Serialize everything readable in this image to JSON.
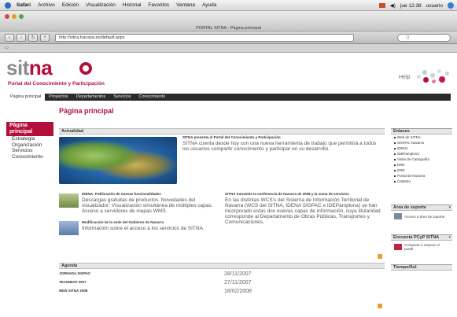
{
  "menubar": {
    "app": "Safari",
    "items": [
      "Archivo",
      "Edición",
      "Visualización",
      "Historial",
      "Favoritos",
      "Ventana",
      "Ayuda"
    ],
    "time": "jue 12:38",
    "user": "usuario"
  },
  "window": {
    "title": "PORTAL SITNA - Página principal",
    "url": "http://sitna.tracasa.es/default.aspx"
  },
  "site": {
    "logo": "sitna",
    "tagline": "Portal del Conocimiento y Participación",
    "help": "Help",
    "nav": [
      "Página principal",
      "Proyectos",
      "Departamentos",
      "Servicios",
      "Conocimiento"
    ],
    "page_title": "Página principal"
  },
  "leftnav": {
    "header": "Página principal",
    "items": [
      "Estrategia",
      "Organización",
      "Servicios",
      "Conocimiento"
    ]
  },
  "main": {
    "actualidad_header": "Actualidad",
    "lead_title": "SITNA presenta el Portal del Conocimiento y Participación",
    "lead_body": "SITNA cuenta desde hoy con una nueva herramienta de trabajo que permitirá a todos los usuarios compartir conocimiento y participar en su desarrollo.",
    "news1_title": "IDENA: Publicación de nuevas funcionalidades",
    "news1_body": "Descargas gratuitas de productos. Novedades del visualizador: Visualización simultánea de múltiples capas. Acceso a servidores de mapas WMS.",
    "news2_title": "Modificación de la sede del Gobierno de Navarra",
    "news2_body": "Información sobre el acceso a los servicios de SITNA.",
    "news3_title": "SITNA transmite la conferencia de Navarra de 2008 y la suma de servicios",
    "news3_body": "En las distintas WCS's del Sistema de Información Territorial de Navarra (WCS del SITNA, IDENA SIGPAC e IDEPamplona) se han incorporado estas dos nuevas capas de información, cuya titularidad corresponde al Departamento de Obras Públicas, Transportes y Comunicaciones.",
    "agenda_header": "Agenda",
    "agenda": [
      {
        "event": "JORNADA SIGPAC",
        "date": "28/11/2007"
      },
      {
        "event": "TECNIMAP 2007",
        "date": "27/11/2007"
      },
      {
        "event": "NEW SITNA 2008",
        "date": "18/02/2008"
      }
    ]
  },
  "sidebar": {
    "enlaces_header": "Enlaces",
    "enlaces": [
      "Web de SITNA",
      "SIGPAC Navarra",
      "IDENA",
      "IDEPamplona",
      "Visita de Cartografía",
      "ERD",
      "ERD",
      "Portal de Navarra",
      "Catastro"
    ],
    "soporte_header": "Área de soporte",
    "soporte_body": "Acceso a área de soporte",
    "encuesta_header": "Encuesta PCyP SITNA",
    "encuesta_body": "Comparte a mejorar el portal",
    "tiempo_header": "Tiempo/Sol"
  },
  "colors": {
    "brand": "#b40f3b",
    "navbar": "#2b2b2b"
  }
}
